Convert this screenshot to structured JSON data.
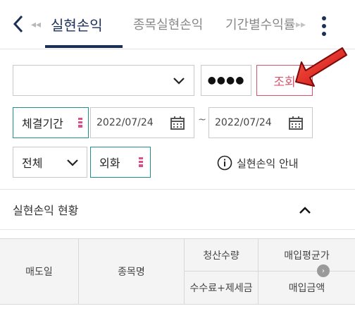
{
  "tabs": [
    {
      "label": "실현손익",
      "active": true
    },
    {
      "label": "종목실현손익",
      "active": false
    },
    {
      "label": "기간별수익률",
      "active": false
    }
  ],
  "icons": {
    "back": "chevron-left-icon",
    "tabs_scroll_left": "double-arrow-left-icon",
    "tabs_scroll_right": "double-arrow-right-icon",
    "more": "vertical-dots-icon",
    "calendar": "calendar-icon",
    "info": "info-circle-icon",
    "collapse": "chevron-up-icon",
    "columns_scroll": "arrow-right-circle-icon"
  },
  "glyphs": {
    "tabs_scroll_left": "◂◂",
    "tabs_scroll_right": "▸▸",
    "columns_scroll": "›"
  },
  "account": {
    "value": "",
    "password_mask": "●●●●"
  },
  "query_button": "조회",
  "period": {
    "label": "체결기간",
    "from": "2022/07/24",
    "separator": "~",
    "to": "2022/07/24"
  },
  "filter": {
    "type_value": "전체",
    "currency_value": "외화",
    "guide_label": "실현손익 안내"
  },
  "section": {
    "title": "실현손익 현황"
  },
  "table": {
    "headers": {
      "sale_date": "매도일",
      "name": "종목명",
      "quantity": "청산수량",
      "avg_price": "매입평균가",
      "fees_tax": "수수료+제세금",
      "purchase_amount": "매입금액"
    }
  },
  "colors": {
    "accent_navy": "#1b2f57",
    "query_red": "#d9536a",
    "teal_border": "#1f8f8f",
    "required_pink": "#e04d8b",
    "annotation_arrow": "#e21d1d"
  }
}
